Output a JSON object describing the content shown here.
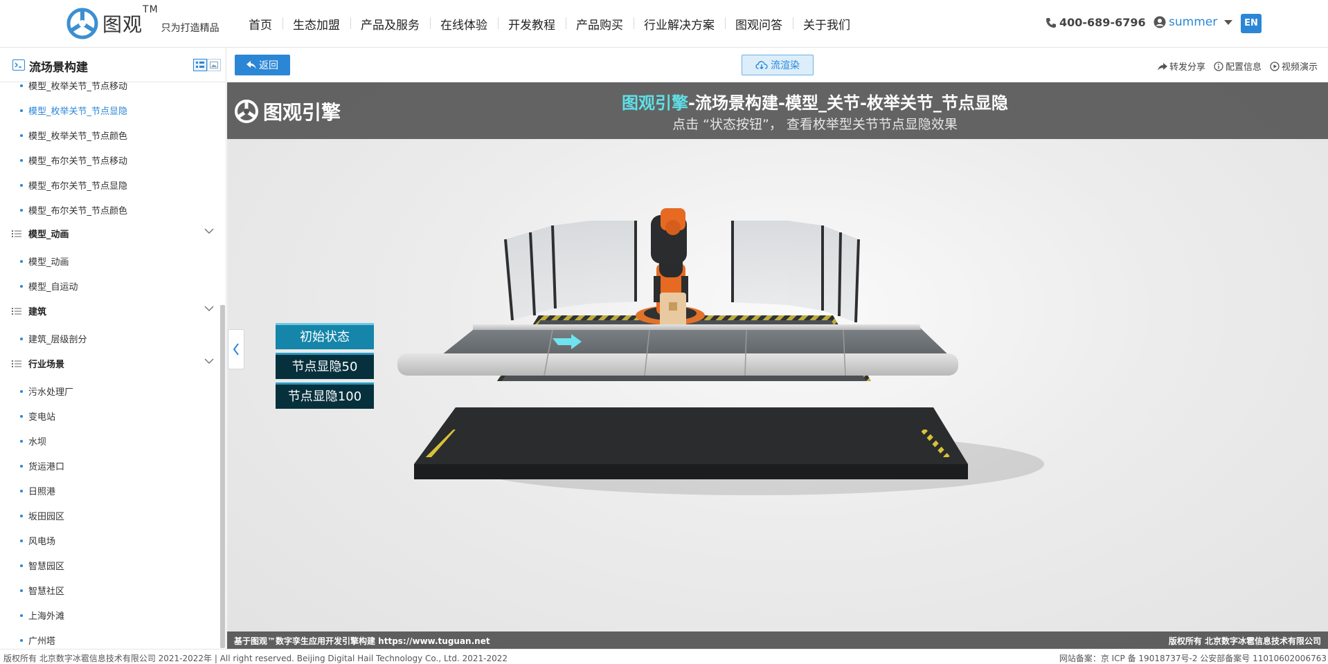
{
  "header": {
    "brand": "图观",
    "trademark": "TM",
    "slogan": "只为打造精品",
    "nav": [
      "首页",
      "生态加盟",
      "产品及服务",
      "在线体验",
      "开发教程",
      "产品购买",
      "行业解决方案",
      "图观问答",
      "关于我们"
    ],
    "phone": "400-689-6796",
    "user": "summer",
    "lang": "EN"
  },
  "sidebar": {
    "title": "流场景构建",
    "items_top": [
      {
        "label": "模型_枚举关节_节点移动",
        "active": false
      },
      {
        "label": "模型_枚举关节_节点显隐",
        "active": true
      },
      {
        "label": "模型_枚举关节_节点颜色",
        "active": false
      },
      {
        "label": "模型_布尔关节_节点移动",
        "active": false
      },
      {
        "label": "模型_布尔关节_节点显隐",
        "active": false
      },
      {
        "label": "模型_布尔关节_节点颜色",
        "active": false
      }
    ],
    "groups": [
      {
        "label": "模型_动画",
        "items": [
          "模型_动画",
          "模型_自运动"
        ]
      },
      {
        "label": "建筑",
        "items": [
          "建筑_层级剖分"
        ]
      },
      {
        "label": "行业场景",
        "items": [
          "污水处理厂",
          "变电站",
          "水坝",
          "货运港口",
          "日照港",
          "坂田园区",
          "风电场",
          "智慧园区",
          "智慧社区",
          "上海外滩",
          "广州塔"
        ]
      }
    ]
  },
  "toolbar": {
    "back": "返回",
    "render": "流渲染",
    "share": "转发分享",
    "config": "配置信息",
    "video": "视频演示"
  },
  "viewport": {
    "logo": "图观引擎",
    "title_highlight": "图观引擎",
    "title_rest": "-流场景构建-模型_关节-枚举关节_节点显隐",
    "subtitle": "点击  “状态按钮”，  查看枚举型关节节点显隐效果",
    "buttons": [
      {
        "label": "初始状态",
        "active": true
      },
      {
        "label": "节点显隐50",
        "active": false
      },
      {
        "label": "节点显隐100",
        "active": false
      }
    ],
    "footer_left": "基于图观™数字孪生应用开发引擎构建 https://www.tuguan.net",
    "footer_right": "版权所有 北京数字冰雹信息技术有限公司"
  },
  "footer": {
    "left": "版权所有 北京数字冰雹信息技术有限公司 2021-2022年 | All right reserved. Beijing Digital Hail Technology Co., Ltd. 2021-2022",
    "right": "网站备案：京 ICP 备 19018737号-2 公安部备案号 11010602006763"
  },
  "colors": {
    "accent": "#2b86d6",
    "highlight": "#5fe0e8",
    "state_active": "#1585a9",
    "state_idle": "#07303d"
  }
}
